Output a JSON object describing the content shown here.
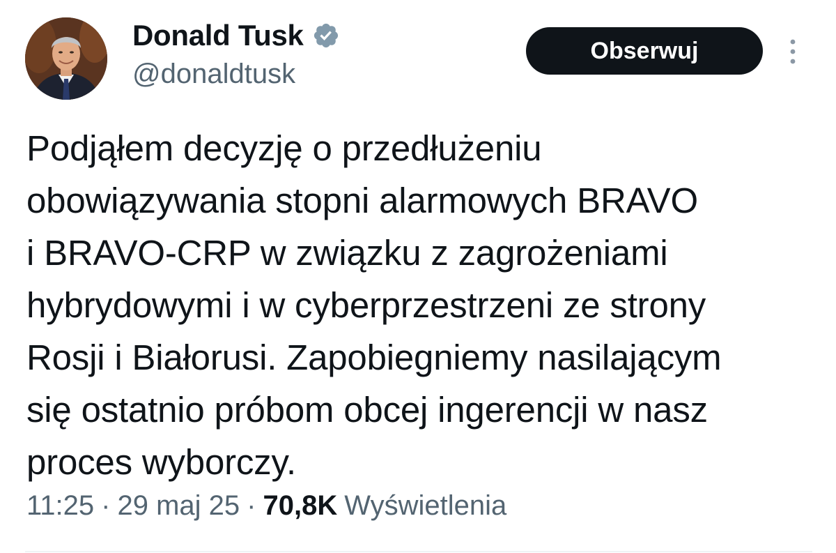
{
  "author": {
    "display_name": "Donald Tusk",
    "handle": "@donaldtusk",
    "verified_icon": "verified-badge-icon",
    "verified_color": "#829aab"
  },
  "actions": {
    "follow_label": "Obserwuj",
    "more_icon": "more-vertical-icon"
  },
  "tweet": {
    "lines": [
      "Podjąłem decyzję o przedłużeniu",
      "obowiązywania stopni alarmowych BRAVO",
      "i BRAVO-CRP w związku z zagrożeniami",
      "hybrydowymi i w cyberprzestrzeni ze strony",
      "Rosji i Białorusi. Zapobiegniemy nasilającym",
      "się ostatnio próbom obcej ingerencji w nasz",
      "proces wyborczy."
    ]
  },
  "meta": {
    "time": "11:25",
    "separator": "·",
    "date": "29 maj 25",
    "views_count": "70,8K",
    "views_label": "Wyświetlenia"
  },
  "colors": {
    "text": "#0f1419",
    "secondary": "#536471",
    "button_bg": "#0f1419",
    "button_text": "#ffffff"
  }
}
